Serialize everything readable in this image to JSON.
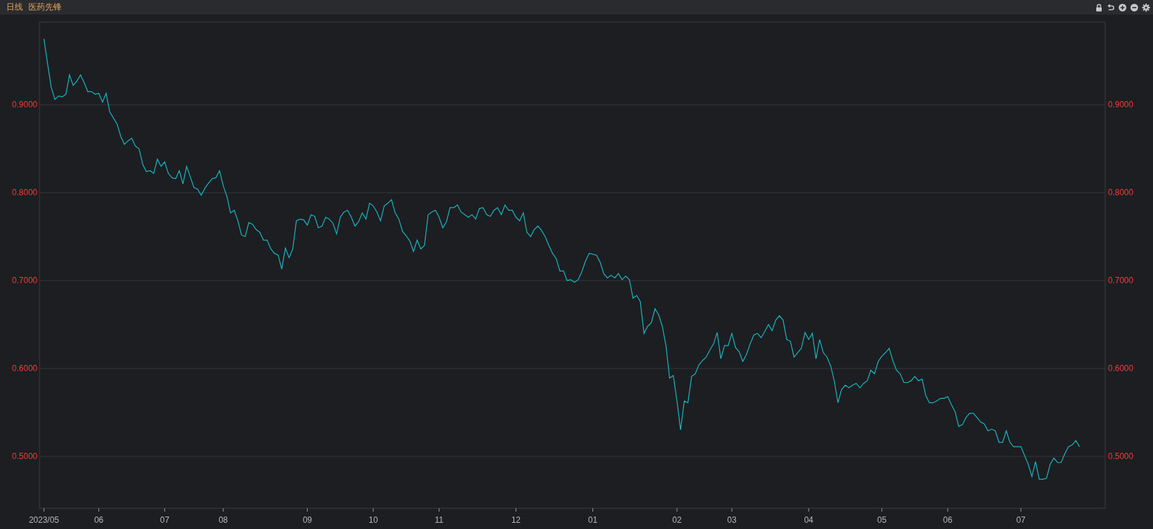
{
  "header": {
    "period": "日线",
    "name": "医药先锋"
  },
  "toolbar": {
    "buttons": [
      {
        "kind": "lock"
      },
      {
        "kind": "undo"
      },
      {
        "kind": "zoom_in"
      },
      {
        "kind": "zoom_out"
      },
      {
        "kind": "settings"
      }
    ]
  },
  "chart_data": {
    "type": "line",
    "categories": [
      "2023/05",
      null,
      null,
      null,
      null,
      null,
      null,
      null,
      null,
      null,
      null,
      null,
      null,
      null,
      null,
      "06",
      null,
      null,
      null,
      null,
      null,
      null,
      null,
      null,
      null,
      null,
      null,
      null,
      null,
      null,
      null,
      null,
      null,
      "07",
      null,
      null,
      null,
      null,
      null,
      null,
      null,
      null,
      null,
      null,
      null,
      null,
      null,
      null,
      null,
      "08",
      null,
      null,
      null,
      null,
      null,
      null,
      null,
      null,
      null,
      null,
      null,
      null,
      null,
      null,
      null,
      null,
      null,
      null,
      null,
      null,
      null,
      null,
      "09",
      null,
      null,
      null,
      null,
      null,
      null,
      null,
      null,
      null,
      null,
      null,
      null,
      null,
      null,
      null,
      null,
      null,
      "10",
      null,
      null,
      null,
      null,
      null,
      null,
      null,
      null,
      null,
      null,
      null,
      null,
      null,
      null,
      null,
      null,
      null,
      "11",
      null,
      null,
      null,
      null,
      null,
      null,
      null,
      null,
      null,
      null,
      null,
      null,
      null,
      null,
      null,
      null,
      null,
      null,
      null,
      null,
      "12",
      null,
      null,
      null,
      null,
      null,
      null,
      null,
      null,
      null,
      null,
      null,
      null,
      null,
      null,
      null,
      null,
      null,
      null,
      null,
      null,
      "01",
      null,
      null,
      null,
      null,
      null,
      null,
      null,
      null,
      null,
      null,
      null,
      null,
      null,
      null,
      null,
      null,
      null,
      null,
      null,
      null,
      null,
      null,
      "02",
      null,
      null,
      null,
      null,
      null,
      null,
      null,
      null,
      null,
      null,
      null,
      null,
      null,
      null,
      "03",
      null,
      null,
      null,
      null,
      null,
      null,
      null,
      null,
      null,
      null,
      null,
      null,
      null,
      null,
      null,
      null,
      null,
      null,
      null,
      null,
      "04",
      null,
      null,
      null,
      null,
      null,
      null,
      null,
      null,
      null,
      null,
      null,
      null,
      null,
      null,
      null,
      null,
      null,
      null,
      null,
      "05",
      null,
      null,
      null,
      null,
      null,
      null,
      null,
      null,
      null,
      null,
      null,
      null,
      null,
      null,
      null,
      null,
      null,
      "06",
      null,
      null,
      null,
      null,
      null,
      null,
      null,
      null,
      null,
      null,
      null,
      null,
      null,
      null,
      null,
      null,
      null,
      null,
      null,
      "07",
      null,
      null,
      null,
      null,
      null,
      null,
      null,
      null,
      null,
      null,
      null,
      null,
      null,
      null,
      null,
      null
    ],
    "values": [
      0.975,
      0.947,
      0.92,
      0.906,
      0.91,
      0.909,
      0.912,
      0.934,
      0.922,
      0.927,
      0.934,
      0.925,
      0.915,
      0.915,
      0.912,
      0.913,
      0.903,
      0.913,
      0.892,
      0.885,
      0.878,
      0.864,
      0.855,
      0.859,
      0.862,
      0.853,
      0.85,
      0.832,
      0.824,
      0.825,
      0.822,
      0.838,
      0.83,
      0.835,
      0.822,
      0.817,
      0.816,
      0.825,
      0.81,
      0.83,
      0.818,
      0.806,
      0.804,
      0.797,
      0.805,
      0.811,
      0.816,
      0.817,
      0.825,
      0.808,
      0.796,
      0.777,
      0.78,
      0.768,
      0.752,
      0.75,
      0.766,
      0.764,
      0.758,
      0.755,
      0.746,
      0.746,
      0.736,
      0.731,
      0.729,
      0.713,
      0.737,
      0.726,
      0.736,
      0.768,
      0.77,
      0.769,
      0.763,
      0.775,
      0.773,
      0.76,
      0.762,
      0.772,
      0.77,
      0.765,
      0.753,
      0.772,
      0.778,
      0.78,
      0.772,
      0.762,
      0.767,
      0.777,
      0.77,
      0.788,
      0.785,
      0.778,
      0.768,
      0.785,
      0.788,
      0.792,
      0.777,
      0.77,
      0.756,
      0.751,
      0.745,
      0.733,
      0.746,
      0.736,
      0.74,
      0.775,
      0.778,
      0.78,
      0.772,
      0.76,
      0.767,
      0.783,
      0.783,
      0.786,
      0.778,
      0.775,
      0.772,
      0.775,
      0.77,
      0.782,
      0.783,
      0.775,
      0.773,
      0.78,
      0.783,
      0.775,
      0.786,
      0.78,
      0.78,
      0.772,
      0.768,
      0.777,
      0.755,
      0.75,
      0.758,
      0.762,
      0.757,
      0.75,
      0.74,
      0.731,
      0.725,
      0.711,
      0.711,
      0.7,
      0.701,
      0.698,
      0.701,
      0.71,
      0.722,
      0.731,
      0.73,
      0.729,
      0.721,
      0.708,
      0.703,
      0.706,
      0.703,
      0.708,
      0.701,
      0.705,
      0.701,
      0.68,
      0.683,
      0.676,
      0.64,
      0.648,
      0.652,
      0.668,
      0.661,
      0.648,
      0.626,
      0.589,
      0.592,
      0.563,
      0.53,
      0.563,
      0.561,
      0.591,
      0.594,
      0.604,
      0.609,
      0.613,
      0.621,
      0.628,
      0.641,
      0.611,
      0.626,
      0.626,
      0.64,
      0.624,
      0.619,
      0.608,
      0.616,
      0.628,
      0.638,
      0.64,
      0.635,
      0.642,
      0.65,
      0.643,
      0.655,
      0.66,
      0.655,
      0.633,
      0.631,
      0.613,
      0.618,
      0.623,
      0.641,
      0.633,
      0.64,
      0.611,
      0.633,
      0.618,
      0.613,
      0.603,
      0.586,
      0.561,
      0.576,
      0.581,
      0.578,
      0.581,
      0.583,
      0.578,
      0.583,
      0.586,
      0.598,
      0.594,
      0.608,
      0.614,
      0.618,
      0.623,
      0.609,
      0.598,
      0.594,
      0.584,
      0.584,
      0.586,
      0.591,
      0.586,
      0.588,
      0.569,
      0.561,
      0.561,
      0.563,
      0.566,
      0.566,
      0.568,
      0.559,
      0.551,
      0.534,
      0.536,
      0.544,
      0.549,
      0.549,
      0.544,
      0.539,
      0.537,
      0.529,
      0.531,
      0.529,
      0.516,
      0.516,
      0.529,
      0.516,
      0.511,
      0.511,
      0.511,
      0.501,
      0.491,
      0.477,
      0.494,
      0.474,
      0.474,
      0.475,
      0.491,
      0.498,
      0.493,
      0.493,
      0.503,
      0.511,
      0.513,
      0.518,
      0.511
    ],
    "grid": true,
    "ylim": [
      0.441,
      0.994
    ],
    "yticks": [
      {
        "value": 0.5,
        "label": "0.5000"
      },
      {
        "value": 0.6,
        "label": "0.6000"
      },
      {
        "value": 0.7,
        "label": "0.7000"
      },
      {
        "value": 0.8,
        "label": "0.8000"
      },
      {
        "value": 0.9,
        "label": "0.9000"
      }
    ]
  }
}
